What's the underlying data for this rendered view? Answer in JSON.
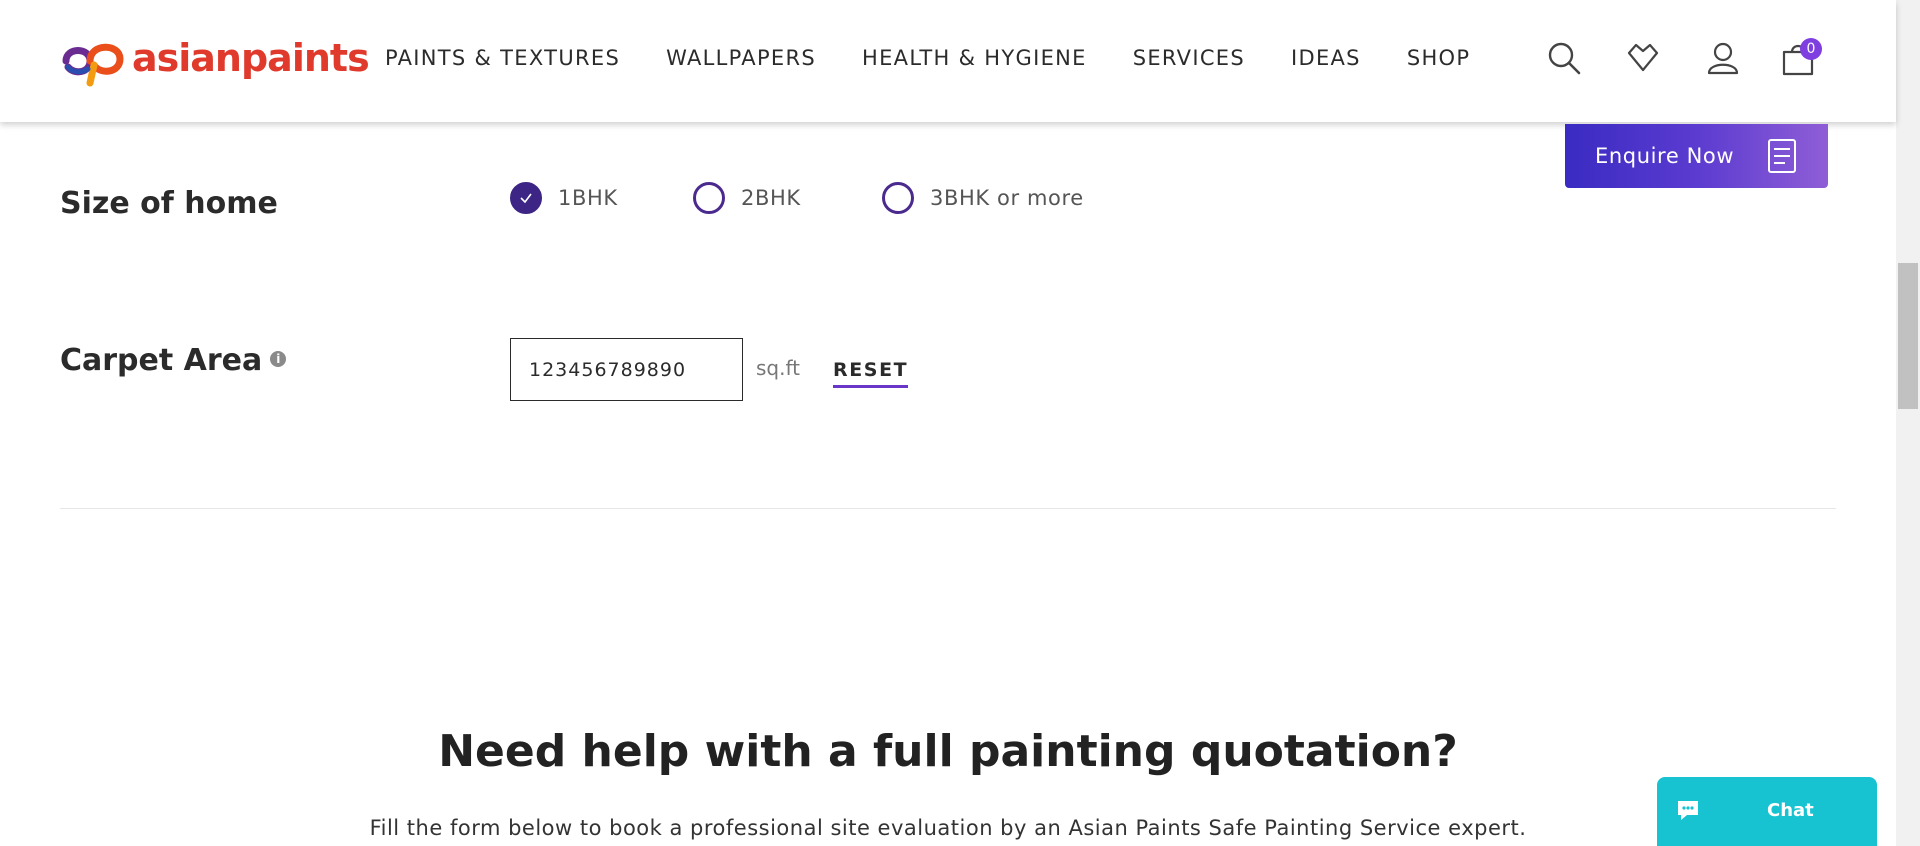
{
  "brand": {
    "name": "asianpaints",
    "color": "#e03a2d"
  },
  "nav": {
    "items": [
      {
        "label": "PAINTS & TEXTURES"
      },
      {
        "label": "WALLPAPERS"
      },
      {
        "label": "HEALTH & HYGIENE"
      },
      {
        "label": "SERVICES"
      },
      {
        "label": "IDEAS"
      },
      {
        "label": "SHOP"
      }
    ],
    "icons": [
      "search-icon",
      "wishlist-heart-icon",
      "user-icon",
      "cart-bag-icon"
    ],
    "cart_count": "0"
  },
  "enquire": {
    "label": "Enquire Now",
    "icon": "document-icon"
  },
  "home_size": {
    "label": "Size of home",
    "options": [
      {
        "label": "1BHK",
        "selected": true
      },
      {
        "label": "2BHK",
        "selected": false
      },
      {
        "label": "3BHK or more",
        "selected": false
      }
    ]
  },
  "carpet_area": {
    "label": "Carpet Area",
    "info_icon": "info-icon",
    "value": "123456789890",
    "unit": "sq.ft",
    "reset_label": "RESET"
  },
  "help": {
    "title": "Need help with a full painting quotation?",
    "subtitle": "Fill the form below to book a professional site evaluation by an Asian Paints Safe Painting Service expert."
  },
  "chat": {
    "label": "Chat",
    "icon": "chat-bubble-icon"
  },
  "colors": {
    "accent_purple": "#3d2585",
    "chat_teal": "#17c3d0"
  }
}
